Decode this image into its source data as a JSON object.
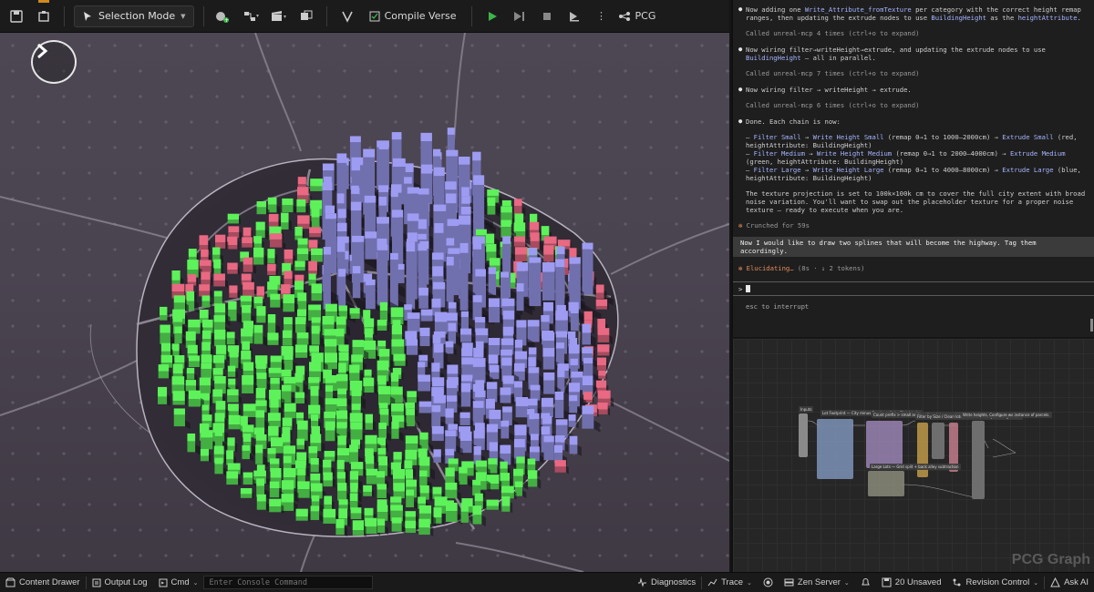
{
  "toolbar": {
    "selection_mode": "Selection Mode",
    "compile": "Compile Verse",
    "pcg": "PCG"
  },
  "chat": {
    "messages": [
      {
        "text_pre": "Now adding one ",
        "hl1": "Write_Attribute_fromTexture",
        "text_mid": " per category with the correct height remap ranges, then updating the extrude nodes to use ",
        "hl2": "BuildingHeight",
        "text_mid2": " as the ",
        "hl3": "heightAttribute",
        "text_post": ".",
        "called": "Called unreal-mcp 4 times (ctrl+o to expand)"
      },
      {
        "text_pre": "Now wiring filter→writeHeight→extrude, and updating the extrude nodes to use ",
        "hl1": "BuildingHeight",
        "text_post": " — all in parallel.",
        "called": "Called unreal-mcp 7 times (ctrl+o to expand)"
      },
      {
        "text_pre": "Now wiring filter → writeHeight → extrude.",
        "called": "Called unreal-mcp 6 times (ctrl+o to expand)"
      }
    ],
    "done_intro": "Done. Each chain is now:",
    "chains": [
      {
        "a": "Filter Small",
        "b": "Write Height Small",
        "mid": " (remap 0→1 to 1000–2000cm) → ",
        "c": "Extrude Small",
        "tail": " (red, heightAttribute: BuildingHeight)"
      },
      {
        "a": "Filter Medium",
        "b": "Write Height Medium",
        "mid": " (remap 0→1 to 2000–4000cm) → ",
        "c": "Extrude Medium",
        "tail": " (green, heightAttribute: BuildingHeight)"
      },
      {
        "a": "Filter Large",
        "b": "Write Height Large",
        "mid": " (remap 0→1 to 4000–8000cm) → ",
        "c": "Extrude Large",
        "tail": " (blue, heightAttribute: BuildingHeight)"
      }
    ],
    "texture_note": "The texture projection is set to 100k×100k cm to cover the full city extent with broad noise variation. You'll want to swap out the placeholder texture for a proper noise texture — ready to execute when you are.",
    "crunched": "Crunched for 59s",
    "user_message": "Now I would like to draw two splines that will become the highway. Tag them accordingly.",
    "elucidating": "Elucidating…",
    "elucidating_meta": "(8s · ↓ 2 tokens)",
    "prompt_symbol": ">",
    "esc_hint": "esc to interrupt"
  },
  "graph": {
    "title": "PCG Graph",
    "labels": {
      "inputs": "Inputs",
      "lot": "Lot Footprint — City minus Roads, split by District size",
      "count": "Count prefix > small and medium lot removal / Eng / Rasterize",
      "filters": "Filter by Size / Clean lots / Bounds / Compute height ex…",
      "parcels": "Write heights. Configure ws instance of parcels.",
      "large": "Large Lots — Grid split + back alley subtraction"
    }
  },
  "statusbar": {
    "content_drawer": "Content Drawer",
    "output_log": "Output Log",
    "cmd": "Cmd",
    "console_placeholder": "Enter Console Command",
    "diagnostics": "Diagnostics",
    "trace": "Trace",
    "zen_server": "Zen Server",
    "unsaved": "20 Unsaved",
    "revision_control": "Revision Control",
    "ask_ai": "Ask AI"
  },
  "colors": {
    "small": "#e96882",
    "medium": "#5df25a",
    "large": "#9d9cf2",
    "accent": "#a6b5ff"
  }
}
